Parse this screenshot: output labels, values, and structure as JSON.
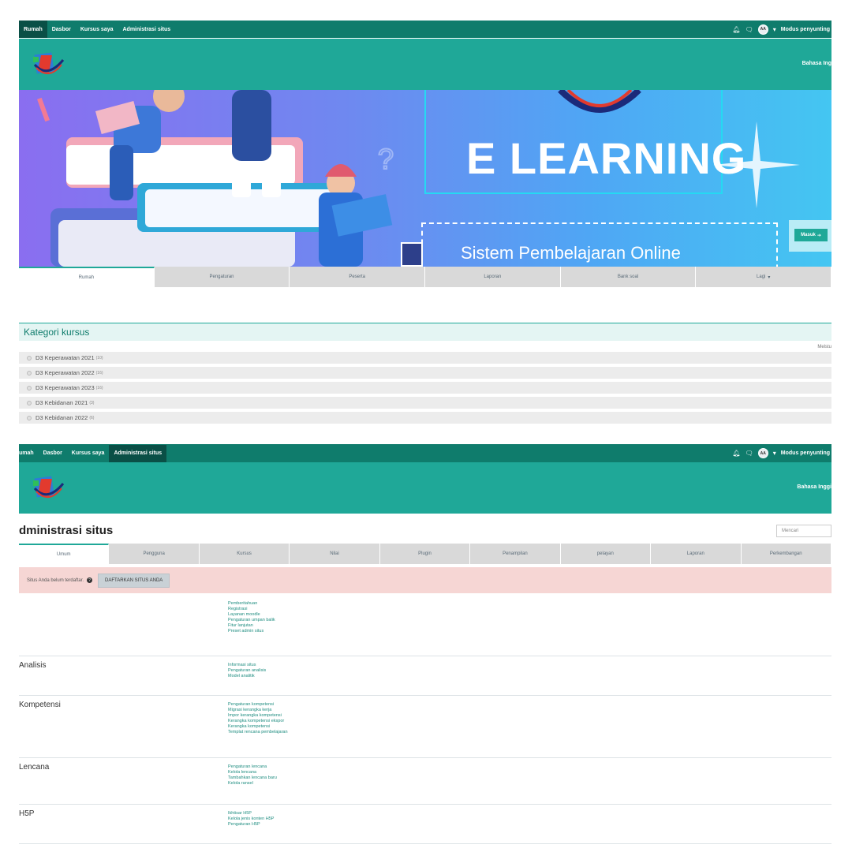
{
  "screen1": {
    "nav": {
      "items": [
        "Rumah",
        "Dasbor",
        "Kursus saya",
        "Administrasi situs"
      ],
      "active_index": 0,
      "avatar": "AA",
      "edit_mode": "Modus penyunting"
    },
    "language": "Bahasa Ing",
    "hero": {
      "title": "E LEARNING",
      "subtitle": "Sistem Pembelajaran Online",
      "login_button": "Masuk"
    },
    "tabs": [
      "Rumah",
      "Pengaturan",
      "Peserta",
      "Laporan",
      "Bank soal",
      "Lagi"
    ],
    "categories": {
      "header": "Kategori kursus",
      "collapse_link": "Melstu",
      "items": [
        {
          "name": "D3 Keperawatan 2021",
          "count": "(10)"
        },
        {
          "name": "D3 Keperawatan 2022",
          "count": "(16)"
        },
        {
          "name": "D3 Keperawatan 2023",
          "count": "(16)"
        },
        {
          "name": "D3 Kebidanan 2021",
          "count": "(3)"
        },
        {
          "name": "D3 Kebidanan 2022",
          "count": "(6)"
        }
      ]
    }
  },
  "screen2": {
    "nav": {
      "items": [
        "umah",
        "Dasbor",
        "Kursus saya",
        "Administrasi situs"
      ],
      "active_index": 3,
      "avatar": "AA",
      "edit_mode": "Modus penyunting"
    },
    "language": "Bahasa Inggi",
    "page_title": "dministrasi situs",
    "search_placeholder": "Mencari",
    "tabs": [
      "Umum",
      "Pengguna",
      "Kursus",
      "Nilai",
      "Plugin",
      "Penampilan",
      "pelayan",
      "Laporan",
      "Perkembangan"
    ],
    "notice": {
      "text": "Situs Anda belum terdaftar.",
      "help_icon": "?",
      "button": "DAFTARKAN SITUS ANDA"
    },
    "sections": [
      {
        "title": "",
        "links": [
          "Pemberitahuan",
          "Registrasi",
          "Layanan moodle",
          "Pengaturan umpan balik",
          "Fitur lanjutan",
          "Preset admin situs"
        ]
      },
      {
        "title": "Analisis",
        "links": [
          "Informasi situs",
          "Pengaturan analisis",
          "Model analitik"
        ]
      },
      {
        "title": "Kompetensi",
        "links": [
          "Pengaturan kompetensi",
          "Migrasi kerangka kerja",
          "Impor kerangka kompetensi",
          "Kerangka kompetensi ekspor",
          "Kerangka kompetensi",
          "Templat rencana pembelajaran"
        ]
      },
      {
        "title": "Lencana",
        "links": [
          "Pengaturan lencana",
          "Kelola lencana",
          "Tambahkan lencana baru",
          "Kelola ransel"
        ]
      },
      {
        "title": "H5P",
        "links": [
          "Ikhtisar H5P",
          "Kelola jenis konten H5P",
          "Pengaturan H5P"
        ]
      }
    ]
  },
  "colors": {
    "nav_bg": "#0f7c6c",
    "header_bg": "#1fa898",
    "accent": "#1fa898",
    "notice_bg": "#f6d6d4"
  }
}
